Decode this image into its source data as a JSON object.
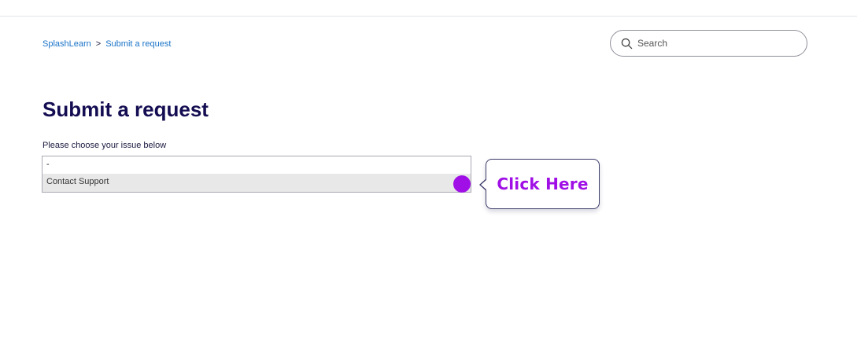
{
  "breadcrumb": {
    "home": "SplashLearn",
    "separator": ">",
    "current": "Submit a request"
  },
  "search": {
    "placeholder": "Search",
    "value": ""
  },
  "page": {
    "title": "Submit a request"
  },
  "form": {
    "issue_label": "Please choose your issue below",
    "issue_select": {
      "selected": "-",
      "options": [
        "Contact Support"
      ]
    }
  },
  "callout": {
    "text": "Click Here",
    "accent_color": "#a010e6"
  },
  "icons": {
    "search": "search-icon"
  }
}
